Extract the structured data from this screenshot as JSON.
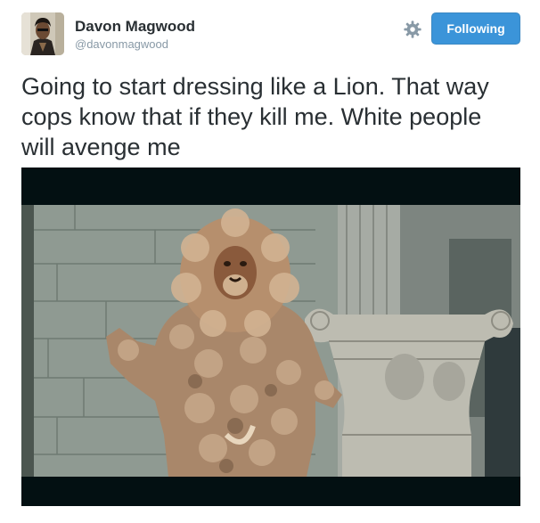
{
  "user": {
    "display_name": "Davon Magwood",
    "handle": "@davonmagwood"
  },
  "actions": {
    "follow_label": "Following",
    "settings_icon": "gear-icon"
  },
  "tweet": {
    "text": "Going to start dressing like a Lion. That way cops know that if they kill me. White people will avenge me"
  },
  "colors": {
    "button_blue": "#3b94d9",
    "name": "#292f33",
    "handle": "#8899a6",
    "letterbox": "#031012"
  }
}
